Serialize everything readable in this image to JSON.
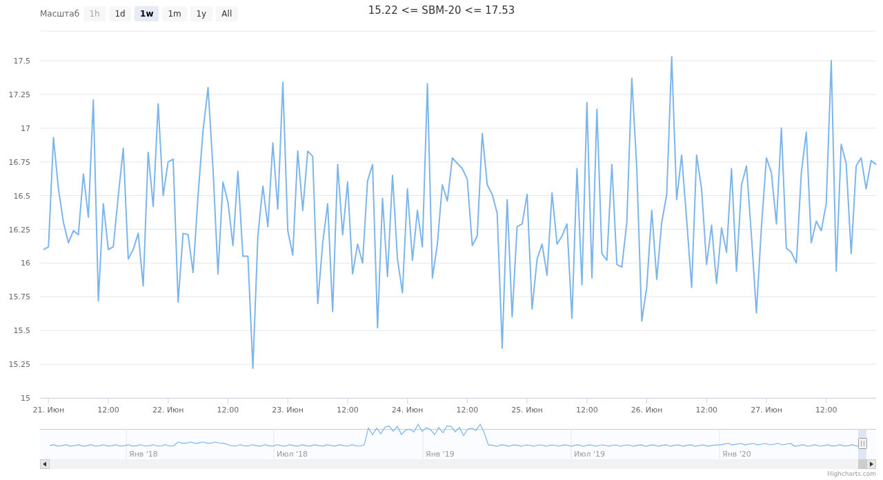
{
  "range_selector": {
    "label": "Масштаб",
    "buttons": [
      {
        "label": "1h",
        "selected": false,
        "disabled": true
      },
      {
        "label": "1d",
        "selected": false,
        "disabled": false
      },
      {
        "label": "1w",
        "selected": true,
        "disabled": false
      },
      {
        "label": "1m",
        "selected": false,
        "disabled": false
      },
      {
        "label": "1y",
        "selected": false,
        "disabled": false
      },
      {
        "label": "All",
        "selected": false,
        "disabled": false
      }
    ]
  },
  "title": "15.22 <= SBM-20 <= 17.53",
  "chart": {
    "chart_data": {
      "type": "line",
      "grid": true,
      "ylim": [
        15,
        17.72
      ],
      "categories": [
        null,
        "21. Июн",
        null,
        null,
        null,
        null,
        null,
        null,
        null,
        null,
        null,
        null,
        null,
        "12:00",
        null,
        null,
        null,
        null,
        null,
        null,
        null,
        null,
        null,
        null,
        null,
        "22. Июн",
        null,
        null,
        null,
        null,
        null,
        null,
        null,
        null,
        null,
        null,
        null,
        "12:00",
        null,
        null,
        null,
        null,
        null,
        null,
        null,
        null,
        null,
        null,
        null,
        "23. Июн",
        null,
        null,
        null,
        null,
        null,
        null,
        null,
        null,
        null,
        null,
        null,
        "12:00",
        null,
        null,
        null,
        null,
        null,
        null,
        null,
        null,
        null,
        null,
        null,
        "24. Июн",
        null,
        null,
        null,
        null,
        null,
        null,
        null,
        null,
        null,
        null,
        null,
        "12:00",
        null,
        null,
        null,
        null,
        null,
        null,
        null,
        null,
        null,
        null,
        null,
        "25. Июн",
        null,
        null,
        null,
        null,
        null,
        null,
        null,
        null,
        null,
        null,
        null,
        "12:00",
        null,
        null,
        null,
        null,
        null,
        null,
        null,
        null,
        null,
        null,
        null,
        "26. Июн",
        null,
        null,
        null,
        null,
        null,
        null,
        null,
        null,
        null,
        null,
        null,
        "12:00",
        null,
        null,
        null,
        null,
        null,
        null,
        null,
        null,
        null,
        null,
        null,
        "27. Июн",
        null,
        null,
        null,
        null,
        null,
        null,
        null,
        null,
        null,
        null,
        null,
        "12:00",
        null,
        null,
        null,
        null,
        null,
        null,
        null,
        null,
        null,
        null
      ],
      "yticks": [
        {
          "value": 15,
          "label": "15"
        },
        {
          "value": 15.25,
          "label": "15.25"
        },
        {
          "value": 15.5,
          "label": "15.5"
        },
        {
          "value": 15.75,
          "label": "15.75"
        },
        {
          "value": 16,
          "label": "16"
        },
        {
          "value": 16.25,
          "label": "16.25"
        },
        {
          "value": 16.5,
          "label": "16.5"
        },
        {
          "value": 16.75,
          "label": "16.75"
        },
        {
          "value": 17,
          "label": "17"
        },
        {
          "value": 17.25,
          "label": "17.25"
        },
        {
          "value": 17.5,
          "label": "17.5"
        }
      ],
      "series": [
        {
          "color": "#7cb5ec",
          "values": [
            16.1,
            16.12,
            16.93,
            16.55,
            16.3,
            16.15,
            16.24,
            16.21,
            16.66,
            16.34,
            17.21,
            15.72,
            16.44,
            16.1,
            16.12,
            16.5,
            16.85,
            16.03,
            16.1,
            16.22,
            15.83,
            16.82,
            16.42,
            17.18,
            16.5,
            16.75,
            16.77,
            15.71,
            16.22,
            16.21,
            15.93,
            16.5,
            16.98,
            17.3,
            16.7,
            15.92,
            16.6,
            16.45,
            16.13,
            16.68,
            16.05,
            16.05,
            15.22,
            16.2,
            16.57,
            16.27,
            16.89,
            16.4,
            17.34,
            16.24,
            16.06,
            16.83,
            16.39,
            16.83,
            16.79,
            15.7,
            16.15,
            16.44,
            15.64,
            16.73,
            16.21,
            16.6,
            15.92,
            16.14,
            16.0,
            16.61,
            16.73,
            15.52,
            16.48,
            15.9,
            16.65,
            16.03,
            15.78,
            16.55,
            16.02,
            16.39,
            16.12,
            17.33,
            15.89,
            16.14,
            16.58,
            16.46,
            16.78,
            16.74,
            16.7,
            16.62,
            16.13,
            16.2,
            16.96,
            16.58,
            16.51,
            16.37,
            15.37,
            16.47,
            15.6,
            16.27,
            16.29,
            16.51,
            15.66,
            16.03,
            16.14,
            15.91,
            16.52,
            16.14,
            16.2,
            16.29,
            15.59,
            16.7,
            15.84,
            17.19,
            15.89,
            17.14,
            16.07,
            16.02,
            16.73,
            15.99,
            15.97,
            16.3,
            17.37,
            16.7,
            15.57,
            15.82,
            16.39,
            15.88,
            16.3,
            16.51,
            17.53,
            16.47,
            16.8,
            16.32,
            15.82,
            16.8,
            16.55,
            15.99,
            16.28,
            15.85,
            16.26,
            16.08,
            16.7,
            15.94,
            16.58,
            16.72,
            16.2,
            15.63,
            16.27,
            16.78,
            16.67,
            16.29,
            17.0,
            16.11,
            16.08,
            16.0,
            16.67,
            16.97,
            16.15,
            16.31,
            16.24,
            16.44,
            17.5,
            15.94,
            16.88,
            16.74,
            16.07,
            16.72,
            16.78,
            16.55,
            16.76,
            16.73
          ]
        }
      ]
    }
  },
  "navigator": {
    "labels": [
      "Янв '18",
      "Июл '18",
      "Янв '19",
      "Июл '19",
      "Янв '20"
    ]
  },
  "credits": "Highcharts.com"
}
